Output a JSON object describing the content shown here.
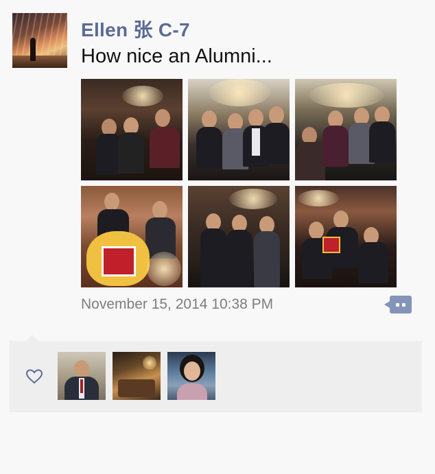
{
  "post": {
    "username": "Ellen 张 C-7",
    "text": "How nice an Alumni...",
    "timestamp": "November 15, 2014 10:38 PM"
  },
  "photos": [
    {
      "name": "photo-1"
    },
    {
      "name": "photo-2"
    },
    {
      "name": "photo-3"
    },
    {
      "name": "photo-4"
    },
    {
      "name": "photo-5"
    },
    {
      "name": "photo-6"
    }
  ],
  "likes": {
    "icon": "heart-icon",
    "liker_count": 3
  },
  "colors": {
    "username": "#5b6b96",
    "accent": "#8493b8",
    "panel_bg": "#eeeeef",
    "page_bg": "#f8f8f8"
  }
}
